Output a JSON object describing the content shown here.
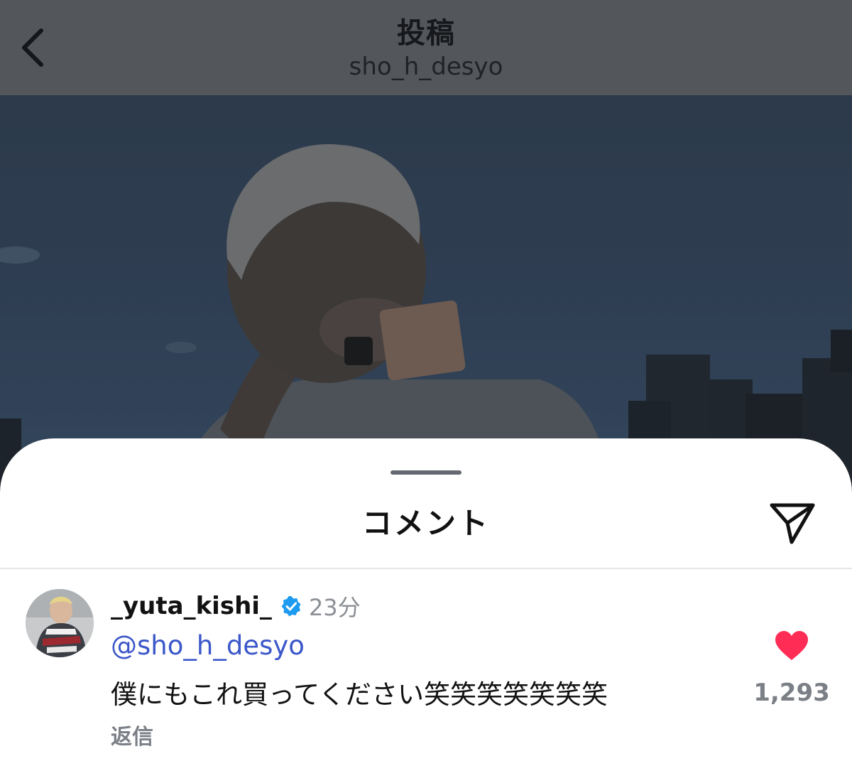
{
  "header": {
    "back_icon": "chevron-left-icon",
    "title": "投稿",
    "subtitle": "sho_h_desyo"
  },
  "photo": {
    "description_icon": "post-photo"
  },
  "comments_sheet": {
    "title": "コメント",
    "share_icon": "send-icon"
  },
  "comment": {
    "username": "_yuta_kishi_",
    "verified_icon": "verified-badge-icon",
    "time": "23分",
    "mention": "@sho_h_desyo",
    "text": "僕にもこれ買ってください笑笑笑笑笑笑笑",
    "reply_label": "返信",
    "like_icon": "heart-icon",
    "like_count": "1,293",
    "like_color": "#ff2d55"
  },
  "colors": {
    "verified": "#1d9bf0",
    "mention": "#3b57c9",
    "muted": "#7b7f86"
  }
}
